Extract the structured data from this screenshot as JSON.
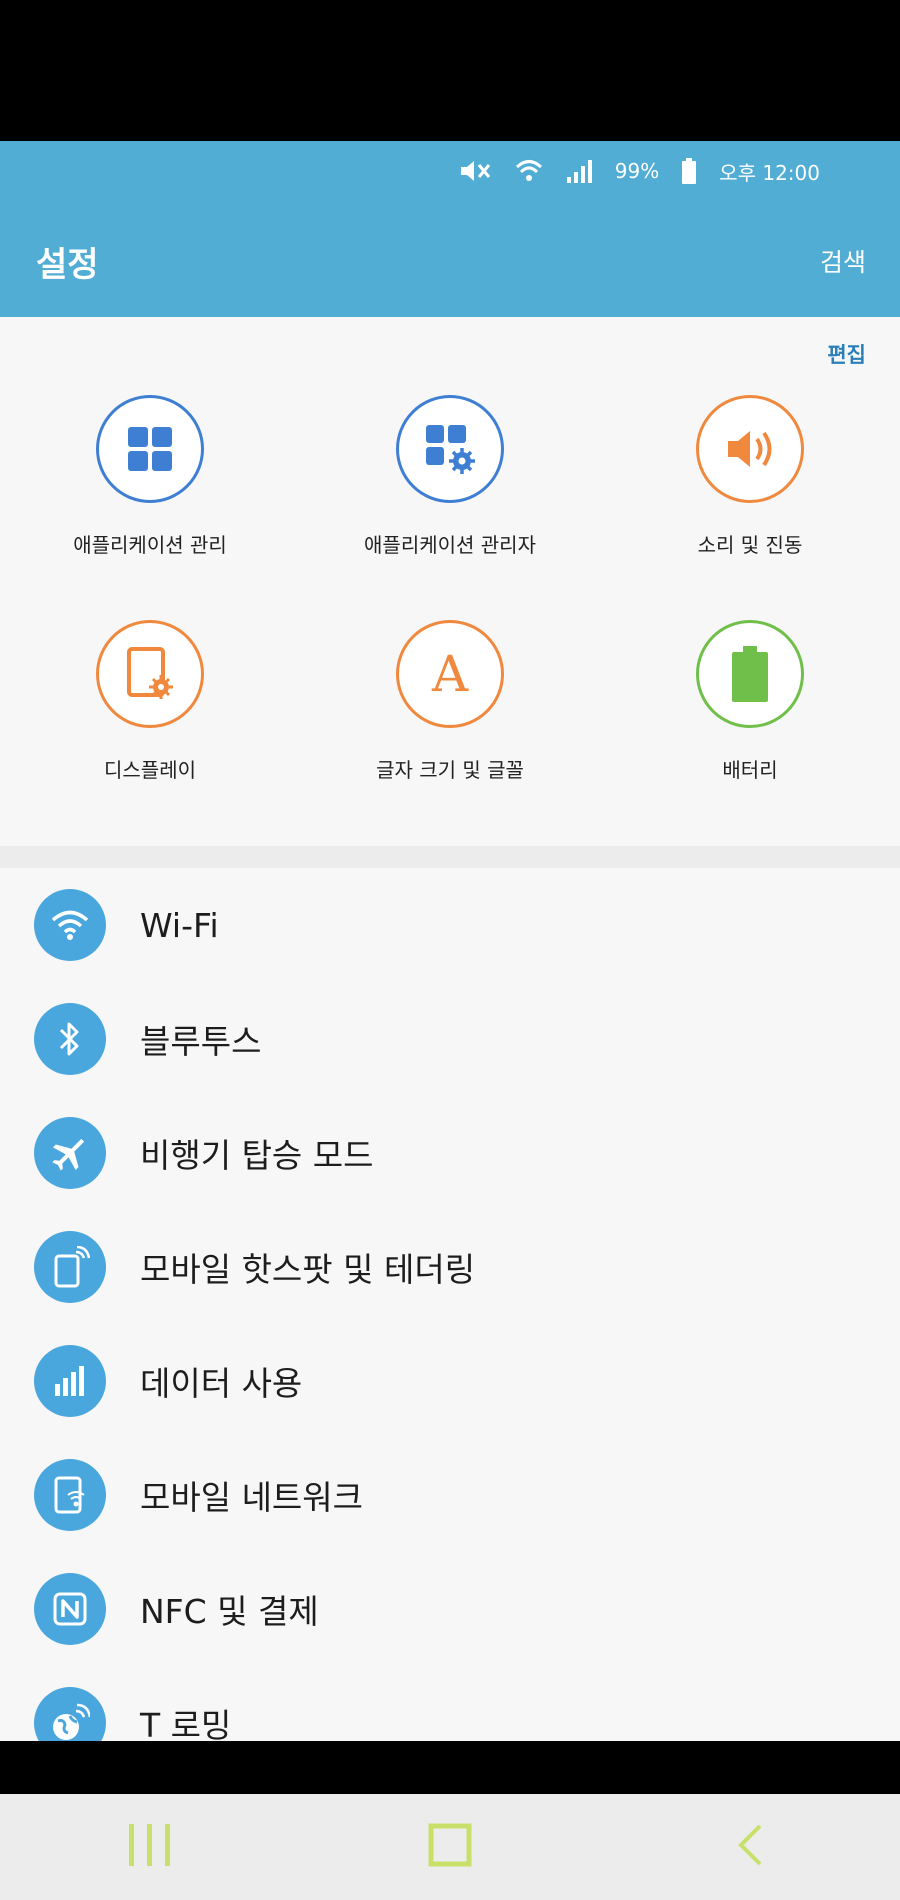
{
  "status_bar": {
    "battery_percent": "99%",
    "time": "오후 12:00",
    "icons": [
      "mute-icon",
      "wifi-icon",
      "signal-icon",
      "battery-icon"
    ]
  },
  "app_bar": {
    "title": "설정",
    "search_label": "검색"
  },
  "quick_settings": {
    "edit_label": "편집",
    "tiles": [
      {
        "label": "애플리케이션 관리",
        "icon": "app-grid-icon",
        "color": "#3f7fd3"
      },
      {
        "label": "애플리케이션 관리자",
        "icon": "app-manager-icon",
        "color": "#3f7fd3"
      },
      {
        "label": "소리 및 진동",
        "icon": "speaker-icon",
        "color": "#f0883e"
      },
      {
        "label": "디스플레이",
        "icon": "display-icon",
        "color": "#f0883e"
      },
      {
        "label": "글자 크기 및 글꼴",
        "icon": "font-icon",
        "color": "#f0883e"
      },
      {
        "label": "배터리",
        "icon": "battery-icon",
        "color": "#6fbf4a"
      }
    ]
  },
  "settings_list": [
    {
      "label": "Wi-Fi",
      "icon": "wifi-icon"
    },
    {
      "label": "블루투스",
      "icon": "bluetooth-icon"
    },
    {
      "label": "비행기 탑승 모드",
      "icon": "airplane-icon"
    },
    {
      "label": "모바일 핫스팟 및 테더링",
      "icon": "hotspot-icon"
    },
    {
      "label": "데이터 사용",
      "icon": "data-usage-icon"
    },
    {
      "label": "모바일 네트워크",
      "icon": "mobile-network-icon"
    },
    {
      "label": "NFC 및 결제",
      "icon": "nfc-icon"
    },
    {
      "label": "T 로밍",
      "icon": "roaming-icon"
    }
  ],
  "nav_bar": {
    "buttons": [
      "recent-apps-icon",
      "home-icon",
      "back-icon"
    ],
    "color": "#c8e06a"
  },
  "colors": {
    "header": "#52add4",
    "list_icon_bg": "#4aa7de",
    "blue_accent": "#3f7fd3",
    "orange_accent": "#f0883e",
    "green_accent": "#6fbf4a"
  }
}
